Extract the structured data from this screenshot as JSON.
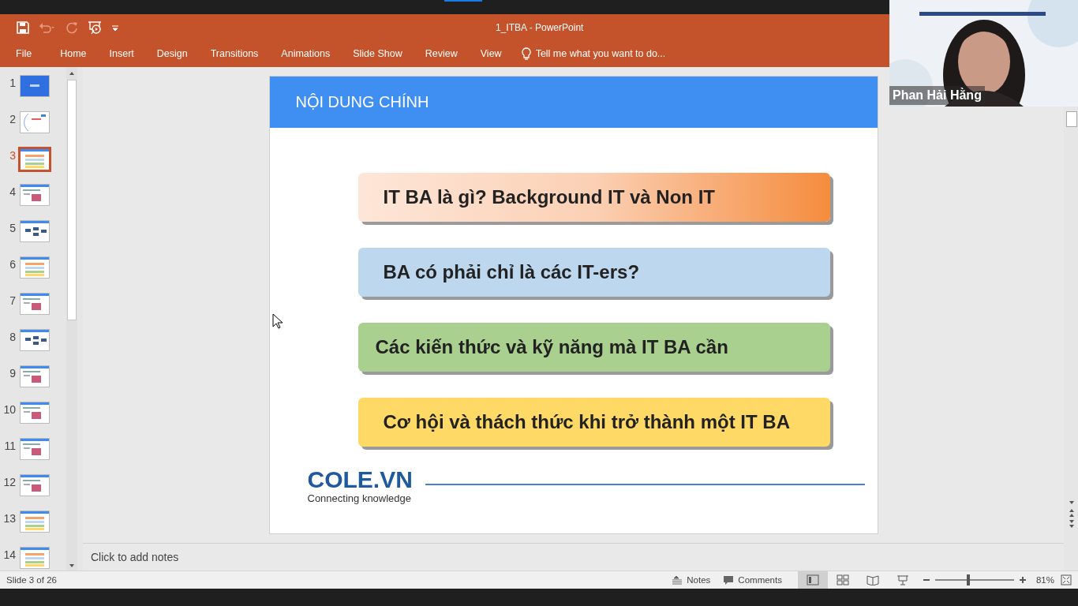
{
  "window": {
    "title": "1_ITBA - PowerPoint"
  },
  "menu": [
    {
      "label": "File"
    },
    {
      "label": "Home"
    },
    {
      "label": "Insert"
    },
    {
      "label": "Design"
    },
    {
      "label": "Transitions"
    },
    {
      "label": "Animations"
    },
    {
      "label": "Slide Show"
    },
    {
      "label": "Review"
    },
    {
      "label": "View"
    }
  ],
  "tell_me": {
    "placeholder": "Tell me what you want to do..."
  },
  "thumbnails": [
    {
      "number": "1",
      "kind": "title",
      "selected": false
    },
    {
      "number": "2",
      "kind": "plain",
      "selected": false
    },
    {
      "number": "3",
      "kind": "list",
      "selected": true
    },
    {
      "number": "4",
      "selected": false
    },
    {
      "number": "5",
      "kind": "diagram",
      "selected": false
    },
    {
      "number": "6",
      "kind": "list",
      "selected": false
    },
    {
      "number": "7",
      "selected": false
    },
    {
      "number": "8",
      "kind": "diagram",
      "selected": false
    },
    {
      "number": "9",
      "selected": false
    },
    {
      "number": "10",
      "selected": false
    },
    {
      "number": "11",
      "selected": false
    },
    {
      "number": "12",
      "selected": false
    },
    {
      "number": "13",
      "kind": "list",
      "selected": false
    },
    {
      "number": "14",
      "kind": "list",
      "selected": false
    }
  ],
  "slide": {
    "header": "NỘI DUNG CHÍNH",
    "items": [
      {
        "text": "IT BA là gì? Background IT và Non IT",
        "color": "#f58c3e",
        "kind": "gradient"
      },
      {
        "text": "BA có phải chỉ là các IT-ers?",
        "color": "#bdd7ee",
        "kind": "flat"
      },
      {
        "text": "Các kiến thức và kỹ năng mà IT BA cần",
        "color": "#a9d08e",
        "kind": "flat"
      },
      {
        "text": "Cơ hội và thách thức khi trở thành một IT BA",
        "color": "#ffd966",
        "kind": "flat"
      }
    ],
    "logo": "COLE.VN",
    "tagline": "Connecting knowledge"
  },
  "notes": {
    "placeholder": "Click to add notes"
  },
  "status_bar": {
    "slide_info": "Slide 3 of 26",
    "notes": "Notes",
    "comments": "Comments",
    "views": [
      {
        "kind": "normal",
        "selected": true
      },
      {
        "kind": "sorter",
        "selected": false
      },
      {
        "kind": "reading",
        "selected": false
      },
      {
        "kind": "slideshow",
        "selected": false
      }
    ],
    "zoom": {
      "level": 0.4,
      "reading": "81%"
    }
  },
  "video": {
    "name": "Phan Hải Hằng"
  }
}
